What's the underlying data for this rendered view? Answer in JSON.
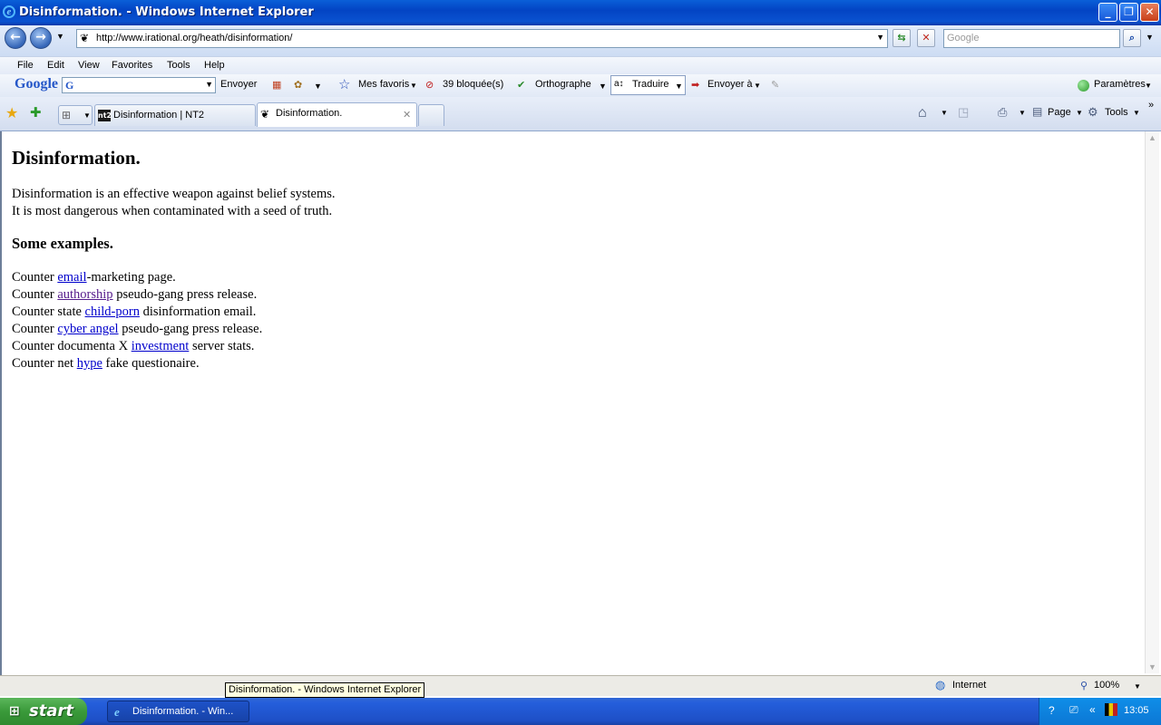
{
  "window": {
    "title": "Disinformation. - Windows Internet Explorer"
  },
  "address": {
    "url": "http://www.irational.org/heath/disinformation/",
    "search_placeholder": "Google"
  },
  "menu": [
    "File",
    "Edit",
    "View",
    "Favorites",
    "Tools",
    "Help"
  ],
  "google_toolbar": {
    "logo": "Google",
    "send": "Envoyer",
    "favorites": "Mes favoris",
    "blocked": "39 bloquée(s)",
    "spelling": "Orthographe",
    "translate": "Traduire",
    "send_to": "Envoyer à",
    "settings": "Paramètres"
  },
  "tabs": [
    {
      "label": "Disinformation | NT2",
      "favicon": "nt2"
    },
    {
      "label": "Disinformation.",
      "favicon": "irational"
    }
  ],
  "command_bar": {
    "page": "Page",
    "tools": "Tools"
  },
  "page": {
    "heading": "Disinformation.",
    "intro_line1": "Disinformation is an effective weapon against belief systems.",
    "intro_line2": "It is most dangerous when contaminated with a seed of truth.",
    "subheading": "Some examples.",
    "examples": [
      {
        "before": "Counter ",
        "link": "email",
        "after": "-marketing page."
      },
      {
        "before": "Counter ",
        "link": "authorship",
        "after": " pseudo-gang press release."
      },
      {
        "before": "Counter state ",
        "link": "child-porn",
        "after": " disinformation email."
      },
      {
        "before": "Counter ",
        "link": "cyber angel",
        "after": " pseudo-gang press release."
      },
      {
        "before": "Counter documenta X ",
        "link": "investment",
        "after": " server stats."
      },
      {
        "before": "Counter net ",
        "link": "hype",
        "after": " fake questionaire."
      }
    ]
  },
  "status": {
    "zone": "Internet",
    "zoom": "100%",
    "tooltip": "Disinformation. - Windows Internet Explorer"
  },
  "taskbar": {
    "start": "start",
    "item": "Disinformation. - Win...",
    "clock": "13:05"
  },
  "colors": {
    "link": "#0000cc",
    "visited_link": "#551a8b"
  }
}
